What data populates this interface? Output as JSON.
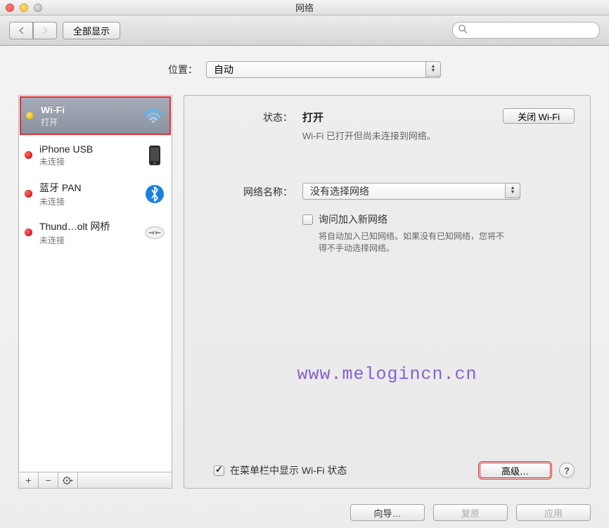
{
  "window": {
    "title": "网络"
  },
  "toolbar": {
    "show_all_label": "全部显示",
    "search_placeholder": ""
  },
  "location": {
    "label": "位置：",
    "value": "自动"
  },
  "services": [
    {
      "name": "Wi-Fi",
      "status": "打开",
      "dot": "yellow",
      "icon": "wifi",
      "selected": true
    },
    {
      "name": "iPhone USB",
      "status": "未连接",
      "dot": "red",
      "icon": "iphone",
      "selected": false
    },
    {
      "name": "蓝牙 PAN",
      "status": "未连接",
      "dot": "red",
      "icon": "bluetooth",
      "selected": false
    },
    {
      "name": "Thund…olt 网桥",
      "status": "未连接",
      "dot": "red",
      "icon": "thunderbolt",
      "selected": false
    }
  ],
  "detail": {
    "status_label": "状态：",
    "status_value": "打开",
    "toggle_label": "关闭 Wi-Fi",
    "status_desc": "Wi-Fi 已打开但尚未连接到网络。",
    "network_name_label": "网络名称：",
    "network_name_value": "没有选择网络",
    "ask_join_label": "询问加入新网络",
    "ask_join_desc": "将自动加入已知网络。如果没有已知网络，您将不得不手动选择网络。",
    "menubar_label": "在菜单栏中显示 Wi-Fi 状态",
    "advanced_label": "高级…"
  },
  "footer": {
    "assist": "向导…",
    "revert": "复原",
    "apply": "应用"
  },
  "watermark": "www.melogincn.cn"
}
